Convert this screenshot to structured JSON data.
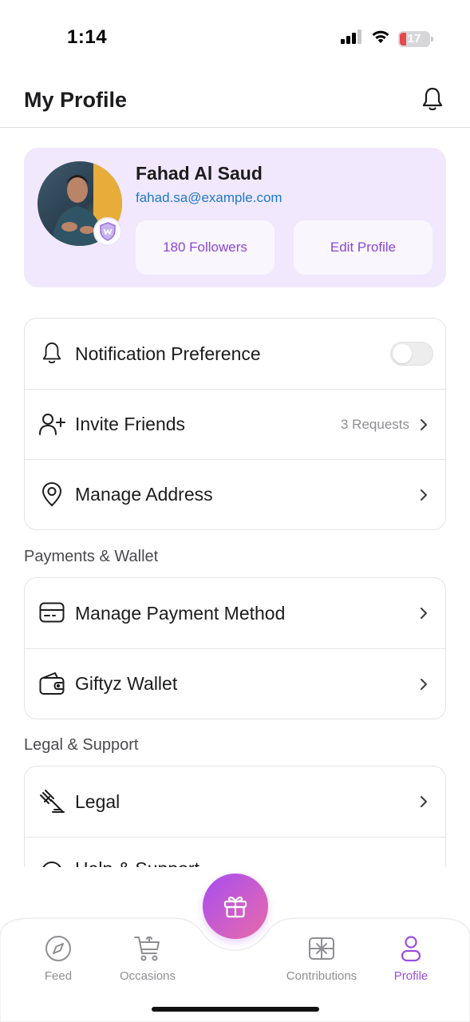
{
  "status_bar": {
    "time": "1:14",
    "battery_level": "17",
    "icons": [
      "cellular-signal-icon",
      "wifi-icon",
      "battery-icon"
    ]
  },
  "header": {
    "title": "My Profile",
    "notification_icon": "bell-icon"
  },
  "profile": {
    "name": "Fahad Al Saud",
    "email": "fahad.sa@example.com",
    "followers_label": "180 Followers",
    "edit_label": "Edit Profile",
    "badge_icon": "shield-badge-icon"
  },
  "settings": {
    "notification_preference": {
      "label": "Notification Preference",
      "enabled": false
    },
    "invite_friends": {
      "label": "Invite Friends",
      "meta": "3 Requests"
    },
    "manage_address": {
      "label": "Manage Address"
    }
  },
  "payments": {
    "title": "Payments & Wallet",
    "items": [
      {
        "label": "Manage Payment Method",
        "icon": "credit-card-icon"
      },
      {
        "label": "Giftyz Wallet",
        "icon": "wallet-icon"
      }
    ]
  },
  "legal": {
    "title": "Legal & Support",
    "items": [
      {
        "label": "Legal",
        "icon": "gavel-icon"
      },
      {
        "label": "Help & Support",
        "icon": "help-icon"
      }
    ]
  },
  "bottom_nav": {
    "items": [
      {
        "label": "Feed",
        "icon": "compass-icon"
      },
      {
        "label": "Occasions",
        "icon": "cart-icon"
      },
      {
        "label": "Contributions",
        "icon": "gift-card-icon"
      },
      {
        "label": "Profile",
        "icon": "user-icon"
      }
    ],
    "active": "Profile",
    "fab_icon": "gift-icon"
  },
  "colors": {
    "accent": "#9b4de0",
    "profile_card_bg": "#f1e8fd",
    "email_link": "#1f79c9"
  }
}
